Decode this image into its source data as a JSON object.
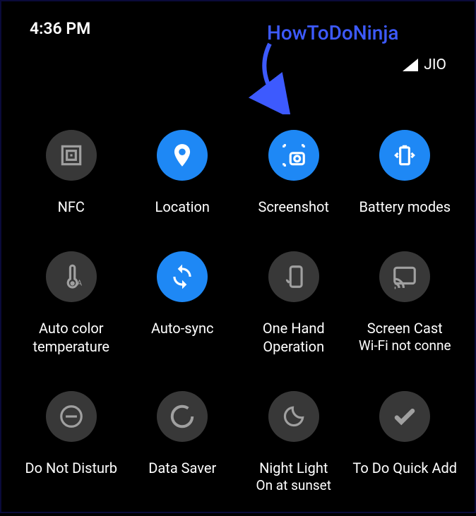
{
  "status": {
    "time": "4:36 PM",
    "carrier": "JIO"
  },
  "annotation": {
    "text": "HowToDoNinja"
  },
  "tiles": [
    {
      "label": "NFC",
      "sublabel": "",
      "active": false,
      "icon": "nfc"
    },
    {
      "label": "Location",
      "sublabel": "",
      "active": true,
      "icon": "location"
    },
    {
      "label": "Screenshot",
      "sublabel": "",
      "active": true,
      "icon": "screenshot"
    },
    {
      "label": "Battery modes",
      "sublabel": "",
      "active": true,
      "icon": "battery"
    },
    {
      "label": "Auto color temperature",
      "sublabel": "",
      "active": false,
      "icon": "thermometer"
    },
    {
      "label": "Auto-sync",
      "sublabel": "",
      "active": true,
      "icon": "sync"
    },
    {
      "label": "One Hand Operation",
      "sublabel": "",
      "active": false,
      "icon": "onehand"
    },
    {
      "label": "Screen Cast",
      "sublabel": "Wi-Fi not conne",
      "active": false,
      "icon": "cast"
    },
    {
      "label": "Do Not Disturb",
      "sublabel": "",
      "active": false,
      "icon": "dnd"
    },
    {
      "label": "Data Saver",
      "sublabel": "",
      "active": false,
      "icon": "datasaver"
    },
    {
      "label": "Night Light",
      "sublabel": "On at sunset",
      "active": false,
      "icon": "moon"
    },
    {
      "label": "To Do Quick Add",
      "sublabel": "",
      "active": false,
      "icon": "check"
    }
  ],
  "colors": {
    "accent": "#1e88f5",
    "annotation": "#3d5afe",
    "tileOff": "#383838"
  }
}
